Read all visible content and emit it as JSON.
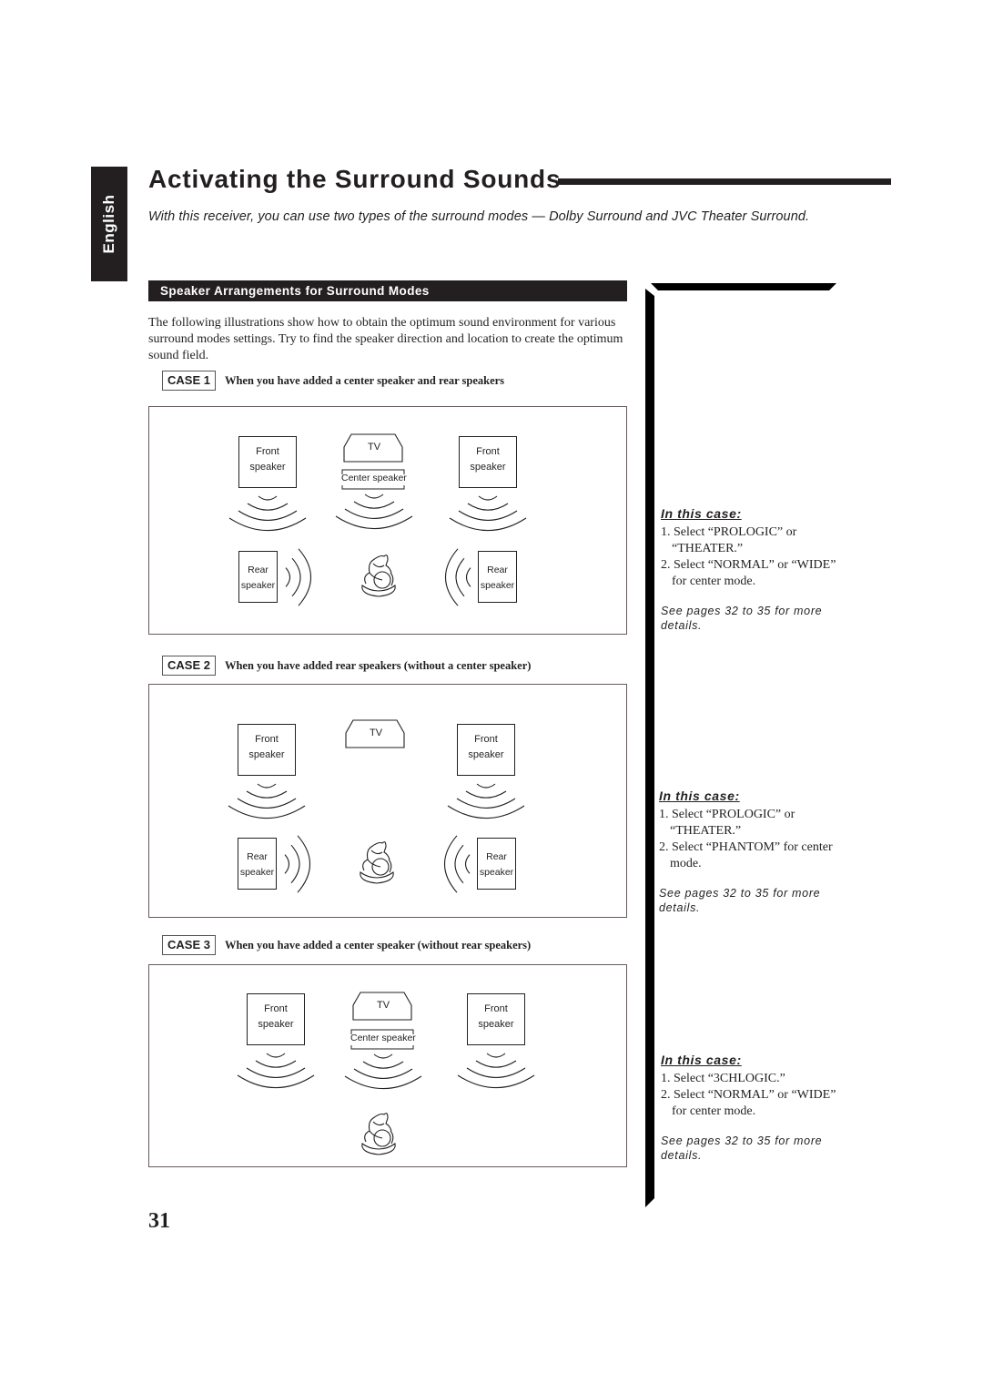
{
  "language_tab": "English",
  "page_title": "Activating the Surround Sounds",
  "intro": "With this receiver, you can use two types of the surround modes — Dolby Surround and JVC Theater Surround.",
  "section": {
    "heading": "Speaker Arrangements for Surround Modes",
    "body": "The following illustrations show how to obtain the optimum sound environment for various surround modes settings. Try to find the speaker direction and location to create the optimum sound field."
  },
  "labels": {
    "front_speaker_line1": "Front",
    "front_speaker_line2": "speaker",
    "rear_speaker_line1": "Rear",
    "rear_speaker_line2": "speaker",
    "tv": "TV",
    "center_speaker": "Center speaker"
  },
  "icons": {
    "sound_wave": "sound-wave-icon",
    "listener": "listener-icon",
    "tv": "tv-icon"
  },
  "cases": [
    {
      "badge": "CASE 1",
      "description": "When you have added a center speaker and rear speakers",
      "has_center": true,
      "has_rear": true,
      "note": {
        "heading": "In this case:",
        "steps": [
          "1. Select “PROLOGIC” or “THEATER.”",
          "2. Select “NORMAL” or “WIDE” for center mode."
        ],
        "reference": "See pages 32 to 35 for more details."
      }
    },
    {
      "badge": "CASE 2",
      "description": "When you have added rear speakers (without a center speaker)",
      "has_center": false,
      "has_rear": true,
      "note": {
        "heading": "In this case:",
        "steps": [
          "1. Select “PROLOGIC” or “THEATER.”",
          "2. Select “PHANTOM” for center mode."
        ],
        "reference": "See pages 32 to 35 for more details."
      }
    },
    {
      "badge": "CASE 3",
      "description": "When you have added a center speaker (without rear speakers)",
      "has_center": true,
      "has_rear": false,
      "note": {
        "heading": "In this case:",
        "steps": [
          "1. Select “3CHLOGIC.”",
          "2. Select “NORMAL” or “WIDE” for center mode."
        ],
        "reference": "See pages 32 to 35 for more details."
      }
    }
  ],
  "page_number": "31"
}
